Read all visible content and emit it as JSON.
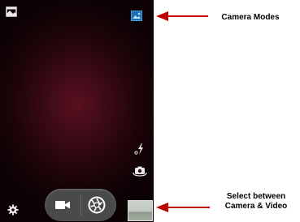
{
  "icons": {
    "panorama": "panorama-icon",
    "camera_mode": "camera-mode-icon",
    "flash": "flash-icon",
    "switch_camera": "switch-camera-icon",
    "settings": "settings-icon",
    "video": "video-camera-icon",
    "shutter": "shutter-icon",
    "thumbnail": "gallery-thumbnail"
  },
  "annotations": {
    "camera_modes": "Camera Modes",
    "select_line1": "Select between",
    "select_line2": "Camera & Video"
  },
  "colors": {
    "arrow": "#c00000",
    "mode_icon": "#3aa0e0",
    "viewfinder": "#3a0a16"
  }
}
